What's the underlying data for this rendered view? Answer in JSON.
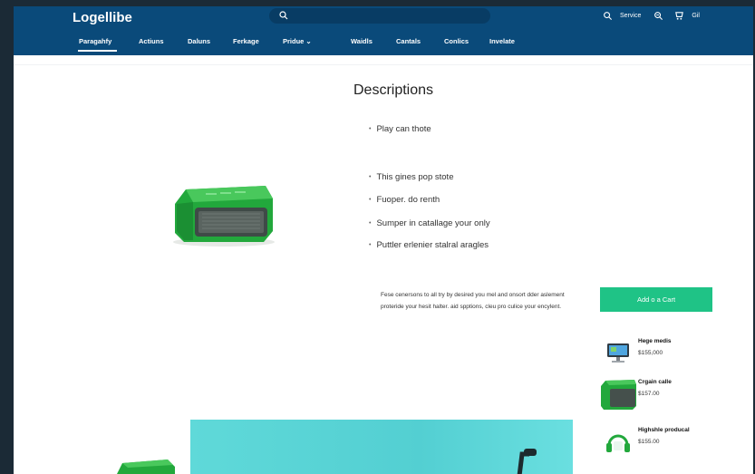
{
  "header": {
    "logo": "Logellibe",
    "service_label": "Service",
    "account_label": "Gil"
  },
  "nav": [
    {
      "label": "Paragahfy",
      "active": true
    },
    {
      "label": "Actiuns"
    },
    {
      "label": "Daluns"
    },
    {
      "label": "Ferkage"
    },
    {
      "label": "Pridue ⌄"
    },
    {
      "label": "Waidls"
    },
    {
      "label": "Cantals"
    },
    {
      "label": "Conlics"
    },
    {
      "label": "Invelate"
    }
  ],
  "product": {
    "title": "Descriptions",
    "bullets": [
      "Play can thote",
      "This gines pop stote",
      "Fuoper. do renth",
      "Sumper in catallage your only",
      "Puttler erlenier stalral aragles"
    ],
    "description": "Fese cenersons to all try by desired you mel and onsort dder aslement proteride your hesit halter. aid spptions, cleu pro culice your encylent.",
    "add_to_cart": "Add o a Cart"
  },
  "related": [
    {
      "name": "Hege medis",
      "price": "$155,000",
      "icon": "monitor-icon"
    },
    {
      "name": "Crgain calle",
      "price": "$157.00",
      "icon": "green-device-icon"
    },
    {
      "name": "Highshle producal",
      "price": "$155.00",
      "icon": "headphones-icon"
    }
  ],
  "colors": {
    "header": "#0a4a7a",
    "accent": "#1fc386",
    "product": "#22a83c"
  }
}
